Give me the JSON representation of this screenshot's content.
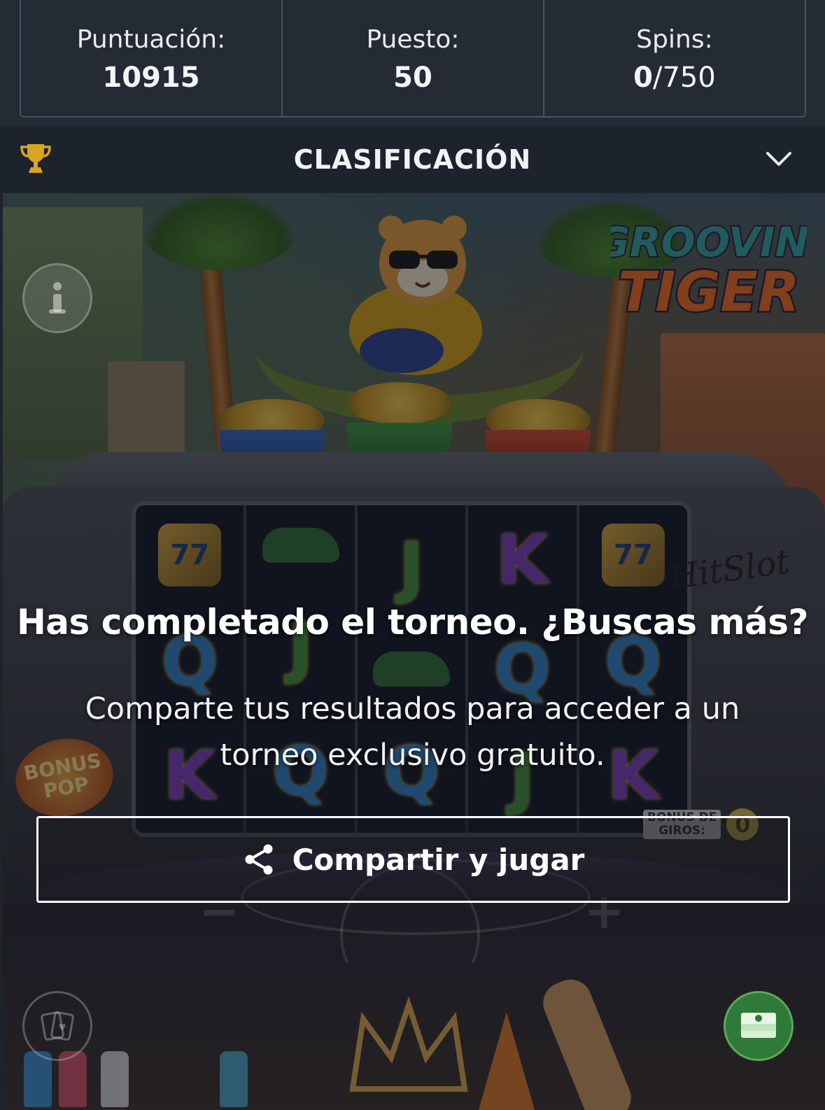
{
  "stats": {
    "score_label": "Puntuación:",
    "score_value": "10915",
    "rank_label": "Puesto:",
    "rank_value": "50",
    "spins_label": "Spins:",
    "spins_used": "0",
    "spins_total": "/750"
  },
  "leaderboard": {
    "title": "CLASIFICACIÓN"
  },
  "game": {
    "logo_line1": "GROOVIN'",
    "logo_line2": "TIGER",
    "brand": "HitSlot",
    "bonus_pop_line1": "BONUS",
    "bonus_pop_line2": "POP",
    "bonus_giros_label_line1": "BONUS DE",
    "bonus_giros_label_line2": "GIROS:",
    "bonus_giros_count": "0",
    "reels": [
      [
        "77",
        "Q",
        "K"
      ],
      [
        "shoe",
        "J",
        "Q"
      ],
      [
        "J",
        "shoe",
        "Q"
      ],
      [
        "K",
        "Q",
        "J"
      ],
      [
        "77",
        "Q",
        "K"
      ]
    ],
    "minus_label": "−",
    "plus_label": "+"
  },
  "modal": {
    "headline": "Has completado el torneo. ¿Buscas más?",
    "subtext": "Comparte tus resultados para acceder a un torneo exclusivo gratuito.",
    "share_button_label": "Compartir y jugar"
  },
  "icons": {
    "trophy": "trophy-icon",
    "chevron": "chevron-down-icon",
    "share": "share-icon",
    "info": "info-icon",
    "cards": "cards-icon",
    "cash": "cash-stack-icon"
  },
  "colors": {
    "header_bg": "#252b35",
    "bar_bg": "#1d232c",
    "trophy_gold": "#d9a422",
    "border": "#4a5262"
  }
}
